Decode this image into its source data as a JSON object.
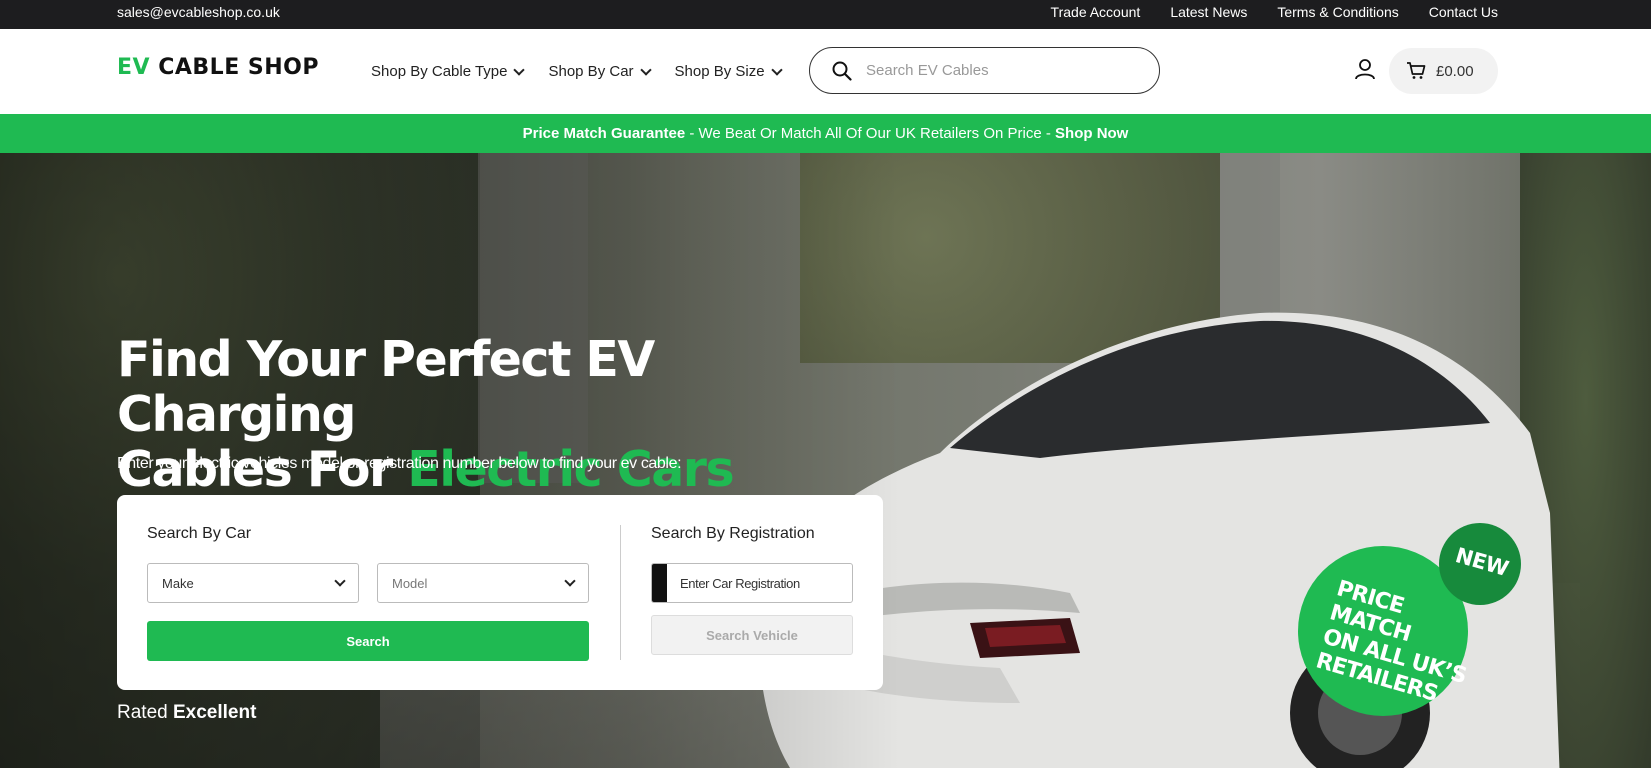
{
  "topbar": {
    "email": "sales@evcableshop.co.uk",
    "links": [
      "Trade Account",
      "Latest News",
      "Terms & Conditions",
      "Contact Us"
    ]
  },
  "header": {
    "logo_ev": "EV",
    "logo_rest": "CABLE SHOP",
    "nav": [
      "Shop By Cable Type",
      "Shop By Car",
      "Shop By Size"
    ],
    "search_placeholder": "Search EV Cables",
    "cart_total": "£0.00"
  },
  "promo": {
    "lead": "Price Match Guarantee",
    "middle": " - We Beat Or Match All Of Our UK Retailers On Price - ",
    "cta": "Shop Now"
  },
  "hero": {
    "title_line1": "Find Your Perfect EV Charging",
    "title_line2_prefix": "Cables For ",
    "title_line2_accent": "Electric Cars",
    "subtitle": "Enter your electric vehicles model or registration number below to find your ev cable:",
    "search_by_car_title": "Search By Car",
    "make_select": "Make",
    "model_select": "Model",
    "search_button": "Search",
    "search_by_reg_title": "Search By Registration",
    "reg_placeholder": "Enter Car Registration",
    "search_vehicle_button": "Search Vehicle",
    "rated_prefix": "Rated ",
    "rated_value": "Excellent"
  },
  "badge": {
    "new": "NEW",
    "text_line1": "PRICE MATCH",
    "text_line2": "ON ALL UK’S",
    "text_line3": "RETAILERS"
  },
  "colors": {
    "brand_green": "#1fba52",
    "dark_green": "#178a3c",
    "topbar_bg": "#1d1d1f"
  },
  "icons": [
    "search-icon",
    "account-icon",
    "cart-icon",
    "chevron-down-icon"
  ]
}
